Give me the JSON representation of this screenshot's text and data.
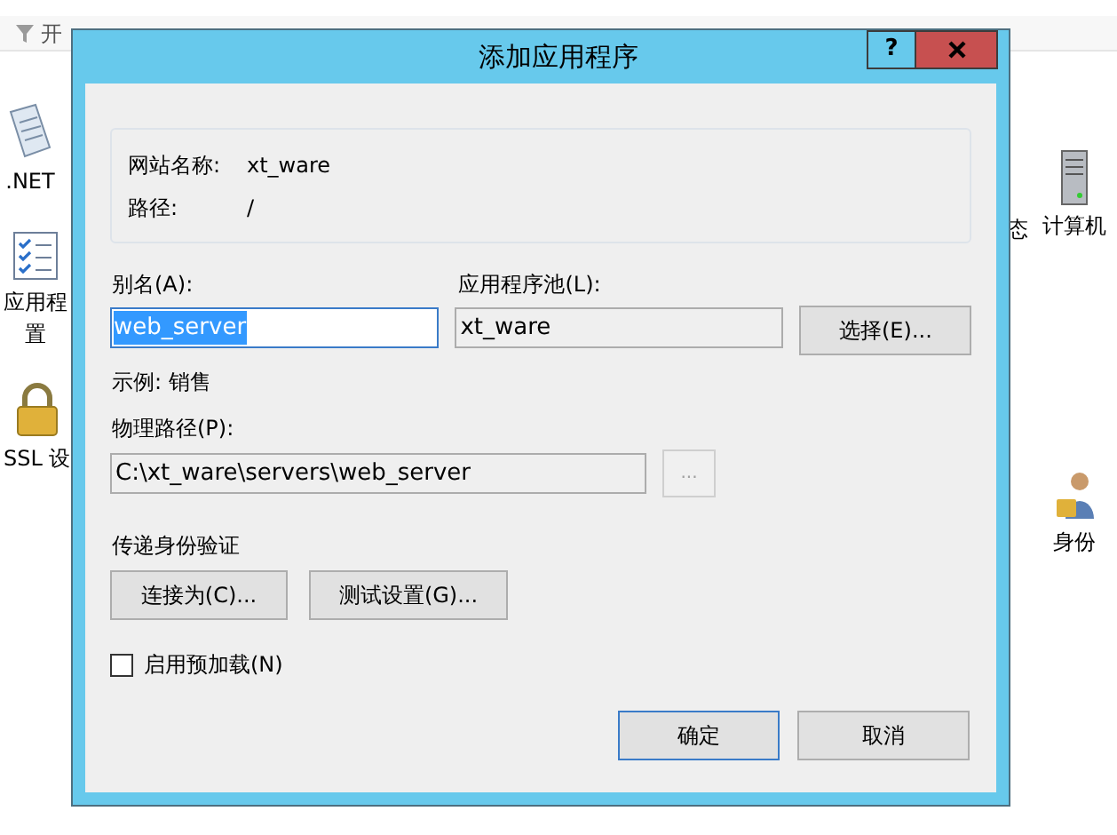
{
  "background": {
    "toolbar": {
      "label": "开"
    },
    "left_features": [
      {
        "lines": [
          ".NET"
        ],
        "kind": "document"
      },
      {
        "lines": [
          "应用程",
          "置"
        ],
        "kind": "checklist"
      },
      {
        "lines": [
          "SSL 设"
        ],
        "kind": "lock"
      }
    ],
    "right_features": [
      {
        "lines": [
          "态"
        ],
        "kind": "text"
      },
      {
        "lines": [
          "计算机"
        ],
        "kind": "server"
      },
      {
        "lines": [
          "身份"
        ],
        "kind": "person"
      }
    ]
  },
  "dialog": {
    "title": "添加应用程序",
    "help_button": "?",
    "site_info": {
      "site_name_label": "网站名称:",
      "site_name": "xt_ware",
      "path_label": "路径:",
      "path": "/"
    },
    "alias": {
      "label": "别名(A):",
      "value": "web_server",
      "text_selected": true
    },
    "app_pool": {
      "label": "应用程序池(L):",
      "value": "xt_ware"
    },
    "select_button": "选择(E)...",
    "example": "示例: 销售",
    "physical_path": {
      "label": "物理路径(P):",
      "value": "C:\\xt_ware\\servers\\web_server"
    },
    "browse_button": {
      "label": "...",
      "disabled": true
    },
    "pass_through": {
      "heading": "传递身份验证",
      "buttons": [
        "连接为(C)...",
        "测试设置(G)..."
      ]
    },
    "preload": {
      "label": "启用预加载(N)",
      "checked": false
    },
    "buttons": [
      {
        "label": "确定",
        "default": true
      },
      {
        "label": "取消",
        "default": false
      }
    ]
  }
}
